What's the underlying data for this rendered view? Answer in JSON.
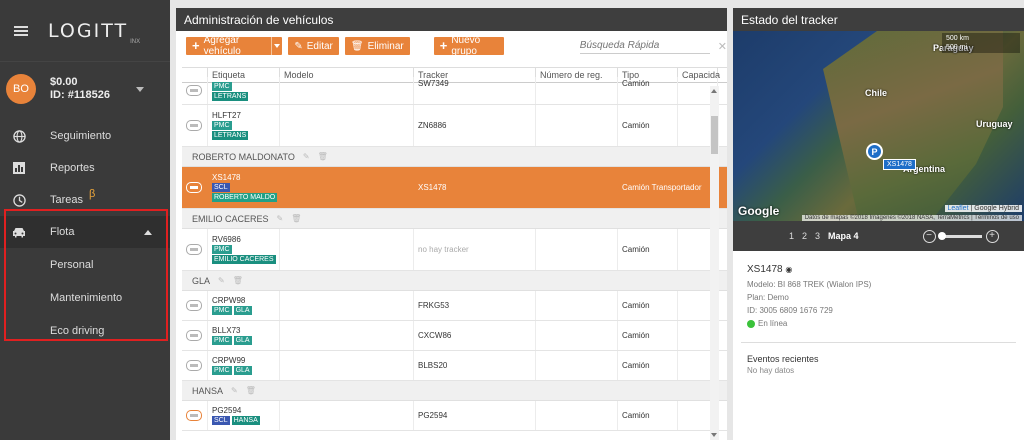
{
  "app": {
    "logo": "LOGITT",
    "logo_sub": "INX"
  },
  "account": {
    "initials": "BO",
    "balance": "$0.00",
    "id": "ID: #118526"
  },
  "nav": {
    "seguimiento": "Seguimiento",
    "reportes": "Reportes",
    "tareas": "Tareas",
    "tareas_badge": "β",
    "flota": "Flota",
    "personal": "Personal",
    "mantenimiento": "Mantenimiento",
    "eco": "Eco driving"
  },
  "vehicles": {
    "title": "Administración de vehículos",
    "btn_add": "Agregar vehículo",
    "btn_edit": "Editar",
    "btn_delete": "Eliminar",
    "btn_group": "Nuevo grupo",
    "search_placeholder": "Búsqueda Rápida",
    "columns": [
      "Etiqueta",
      "Modelo",
      "Tracker",
      "Número de reg.",
      "Tipo",
      "Capacida"
    ],
    "rows": {
      "r1": {
        "label": "",
        "tags": [
          "PMC",
          "LETRANS"
        ],
        "tracker": "SW7349",
        "type": "Camión"
      },
      "r2": {
        "label": "HLFT27",
        "tags": [
          "PMC",
          "LETRANS"
        ],
        "tracker": "ZN6886",
        "type": "Camión"
      },
      "g1": "ROBERTO MALDONATO",
      "r3": {
        "label": "XS1478",
        "tag1": "SCL",
        "tag2": "ROBERTO MALDO",
        "tracker": "XS1478",
        "type": "Camión Transportador"
      },
      "g2": "EMILIO CACERES",
      "r4": {
        "label": "RV6986",
        "tag1": "PMC",
        "tag2": "EMILIO CACERES",
        "tracker": "no hay tracker",
        "type": "Camión"
      },
      "g3": "GLA",
      "r5": {
        "label": "CRPW98",
        "tag1": "PMC",
        "tag2": "GLA",
        "tracker": "FRKG53",
        "type": "Camión"
      },
      "r6": {
        "label": "BLLX73",
        "tag1": "PMC",
        "tag2": "GLA",
        "tracker": "CXCW86",
        "type": "Camión"
      },
      "r7": {
        "label": "CRPW99",
        "tag1": "PMC",
        "tag2": "GLA",
        "tracker": "BLBS20",
        "type": "Camión"
      },
      "g4": "HANSA",
      "r8": {
        "label": "PG2594",
        "tag1": "SCL",
        "tag2": "HANSA",
        "tracker": "PG2594",
        "type": "Camión"
      }
    }
  },
  "tracker": {
    "title": "Estado del tracker",
    "map": {
      "paraguay": "Paraguay",
      "chile": "Chile",
      "uruguay": "Uruguay",
      "argentina": "Argentina",
      "scale_km": "500 km",
      "scale_mi": "500 mi",
      "pin_letter": "P",
      "pin_label": "XS1478",
      "google": "Google",
      "leaflet": "Leaflet",
      "hybrid": "Google Hybrid",
      "attribution": "Datos de mapas ©2018 Imágenes ©2018 NASA, TerraMetrics | Términos de uso"
    },
    "pages": [
      "1",
      "2",
      "3"
    ],
    "active_page": "Mapa 4",
    "name": "XS1478",
    "model": "Modelo: BI 868 TREK (Wialon IPS)",
    "plan": "Plan: Demo",
    "id": "ID: 3005 6809 1676 729",
    "status": "En línea",
    "events_title": "Eventos recientes",
    "events_empty": "No hay datos"
  },
  "colors": {
    "accent": "#e8833a",
    "highlight": "#e02020",
    "sidebar": "#3a3a3a",
    "online": "#3ac23a"
  }
}
